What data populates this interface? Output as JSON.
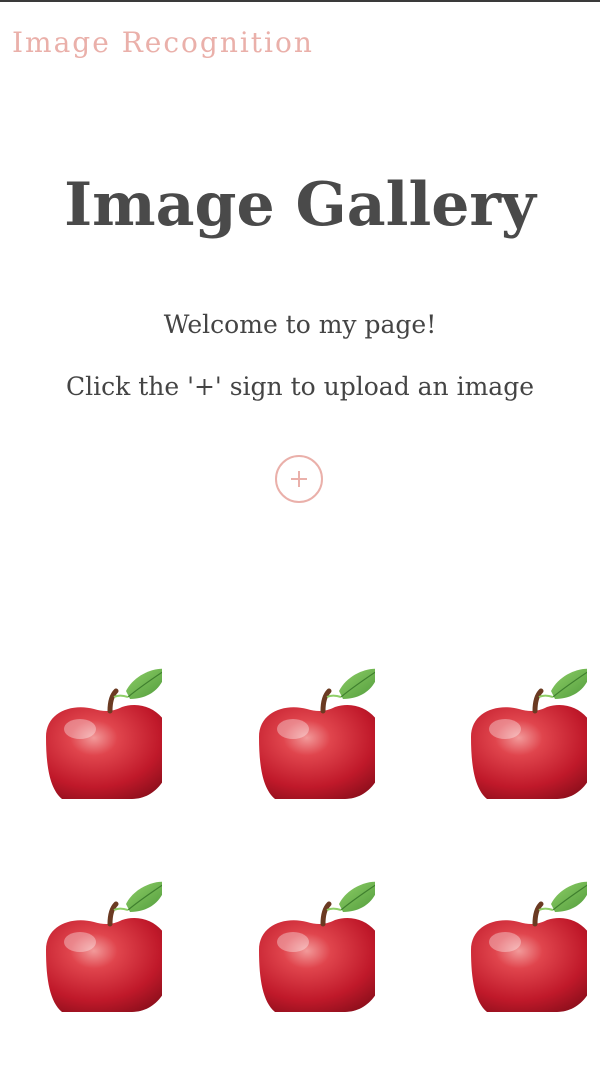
{
  "brand": {
    "title": "Image Recognition",
    "color": "#eab0aa"
  },
  "hero": {
    "title": "Image Gallery",
    "welcome": "Welcome to my page!",
    "instruction": "Click the '+' sign to upload an image"
  },
  "upload_button": {
    "icon": "plus-icon"
  },
  "gallery": {
    "images": [
      {
        "subject": "red-apple"
      },
      {
        "subject": "red-apple"
      },
      {
        "subject": "red-apple"
      },
      {
        "subject": "red-apple"
      },
      {
        "subject": "red-apple"
      },
      {
        "subject": "red-apple"
      }
    ]
  }
}
